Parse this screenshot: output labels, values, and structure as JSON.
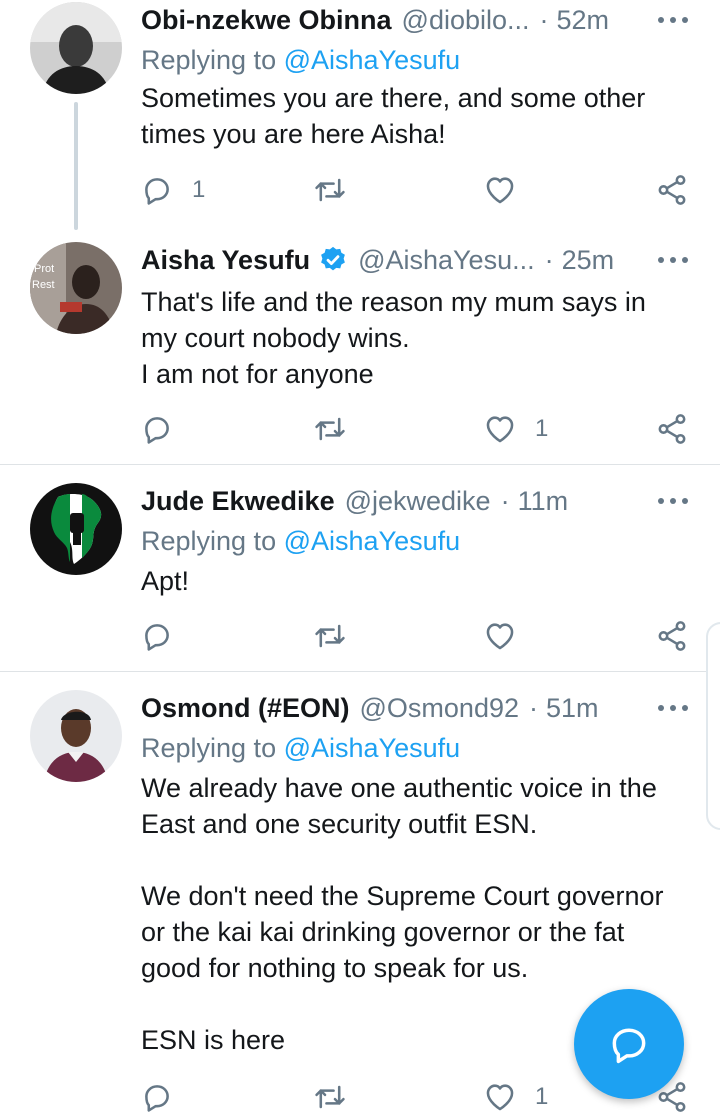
{
  "colors": {
    "accent": "#1da1f2",
    "secondary_text": "#657786",
    "primary_text": "#14171a"
  },
  "tweets": [
    {
      "name": "Obi-nzekwe Obinna",
      "handle": "@diobilo...",
      "separator": "·",
      "time": "52m",
      "reply_prefix": "Replying to",
      "reply_to": "@AishaYesufu",
      "lines": [
        "Sometimes you are there, and some other",
        "times you are here Aisha!"
      ],
      "counts": {
        "replies": "1",
        "retweets": "",
        "likes": ""
      }
    },
    {
      "name": "Aisha Yesufu",
      "verified": true,
      "handle": "@AishaYesu...",
      "separator": "·",
      "time": "25m",
      "lines": [
        "That's life and the reason my mum says in",
        "my court nobody wins.",
        "I am not for anyone"
      ],
      "counts": {
        "replies": "",
        "retweets": "",
        "likes": "1"
      }
    },
    {
      "name": "Jude Ekwedike",
      "handle": "@jekwedike",
      "separator": "·",
      "time": "11m",
      "reply_prefix": "Replying to",
      "reply_to": "@AishaYesufu",
      "lines": [
        "Apt!"
      ],
      "counts": {
        "replies": "",
        "retweets": "",
        "likes": ""
      }
    },
    {
      "name": "Osmond (#EON)",
      "handle": "@Osmond92",
      "separator": "·",
      "time": "51m",
      "reply_prefix": "Replying to",
      "reply_to": "@AishaYesufu",
      "lines": [
        "We already have one authentic voice in the",
        "East and one security outfit ESN.",
        "",
        "We don't need the Supreme Court governor",
        "or the kai kai drinking governor or the fat",
        "good for nothing to speak for us.",
        "",
        "ESN is here"
      ],
      "counts": {
        "replies": "",
        "retweets": "",
        "likes": "1"
      }
    }
  ],
  "icons": {
    "reply": "reply-icon",
    "retweet": "retweet-icon",
    "like": "heart-icon",
    "share": "share-icon",
    "more": "more-icon",
    "compose": "compose-icon"
  }
}
